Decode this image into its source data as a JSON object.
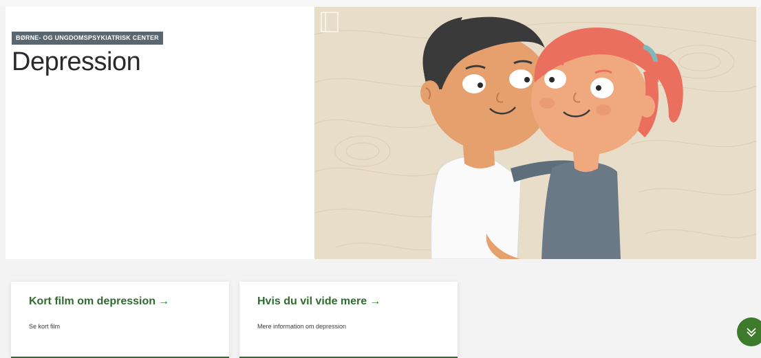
{
  "header": {
    "kicker": "BØRNE- OG UNGDOMSPSYKIATRISK CENTER",
    "title": "Depression"
  },
  "hero": {
    "image": "illustration-hugging-couple"
  },
  "cards": [
    {
      "title": "Kort film om depression",
      "arrow": "→",
      "description": "Se kort film"
    },
    {
      "title": "Hvis du vil vide mere",
      "arrow": "→",
      "description": "Mere information om depression"
    }
  ],
  "scroll_button": {
    "icon": "chevron-double-down-icon"
  },
  "colors": {
    "accent_green": "#2f6b2f",
    "button_green": "#3e7a2c",
    "kicker_bg": "#5a6670",
    "hero_bg": "#e8ddc8"
  }
}
